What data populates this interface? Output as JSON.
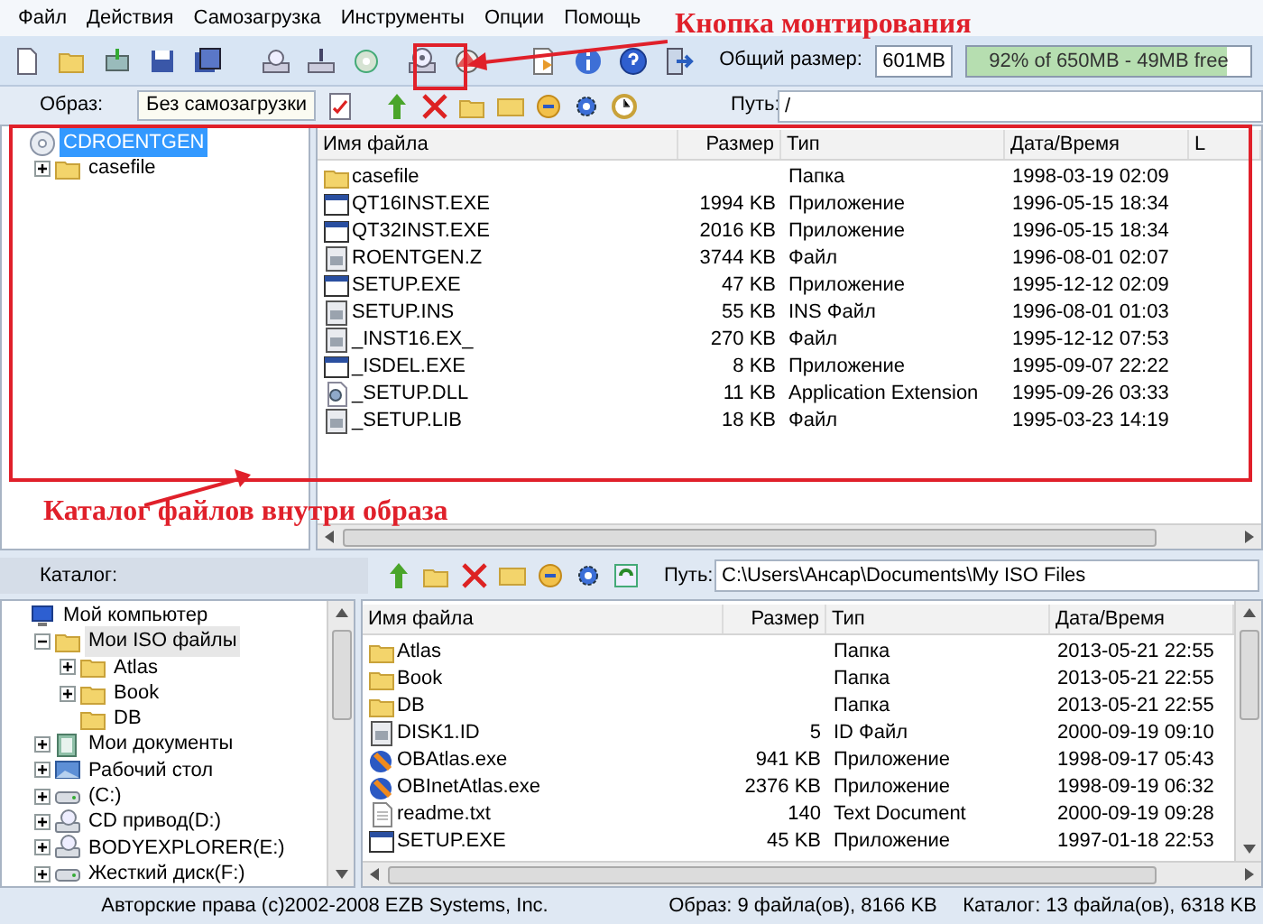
{
  "menu": [
    "Файл",
    "Действия",
    "Самозагрузка",
    "Инструменты",
    "Опции",
    "Помощь"
  ],
  "mount_callout": "Кнопка монтирования",
  "catalog_callout": "Каталог файлов внутри образа",
  "toolbar": {
    "total_size_label": "Общий размер:",
    "total_size": "601MB",
    "capacity": {
      "level": 0.92,
      "text": "92% of 650MB - 49MB free"
    }
  },
  "image_bar": {
    "label": "Образ:",
    "boot": "Без самозагрузки",
    "path_label": "Путь:",
    "path": "/"
  },
  "image_tree": [
    {
      "label": "CDROENTGEN",
      "kind": "cd",
      "selected": true,
      "children": [
        {
          "label": "casefile",
          "kind": "folder",
          "expanded": false,
          "selected": false
        }
      ]
    }
  ],
  "image_files": {
    "columns": [
      "Имя файла",
      "Размер",
      "Тип",
      "Дата/Время",
      "L"
    ],
    "rows": [
      {
        "name": "casefile",
        "size": "",
        "type": "Папка",
        "date": "1998-03-19 02:09",
        "kind": "folder"
      },
      {
        "name": "QT16INST.EXE",
        "size": "1994 KB",
        "type": "Приложение",
        "date": "1996-05-15 18:34",
        "kind": "window"
      },
      {
        "name": "QT32INST.EXE",
        "size": "2016 KB",
        "type": "Приложение",
        "date": "1996-05-15 18:34",
        "kind": "window"
      },
      {
        "name": "ROENTGEN.Z",
        "size": "3744 KB",
        "type": "Файл",
        "date": "1996-08-01 02:07",
        "kind": "file"
      },
      {
        "name": "SETUP.EXE",
        "size": "47 KB",
        "type": "Приложение",
        "date": "1995-12-12 02:09",
        "kind": "window"
      },
      {
        "name": "SETUP.INS",
        "size": "55 KB",
        "type": "INS Файл",
        "date": "1996-08-01 01:03",
        "kind": "file"
      },
      {
        "name": "_INST16.EX_",
        "size": "270 KB",
        "type": "Файл",
        "date": "1995-12-12 07:53",
        "kind": "file"
      },
      {
        "name": "_ISDEL.EXE",
        "size": "8 KB",
        "type": "Приложение",
        "date": "1995-09-07 22:22",
        "kind": "window"
      },
      {
        "name": "_SETUP.DLL",
        "size": "11 KB",
        "type": "Application Extension",
        "date": "1995-09-26 03:33",
        "kind": "gears"
      },
      {
        "name": "_SETUP.LIB",
        "size": "18 KB",
        "type": "Файл",
        "date": "1995-03-23 14:19",
        "kind": "file"
      }
    ]
  },
  "catalog_bar": {
    "label": "Каталог:",
    "path_label": "Путь:",
    "path": "C:\\Users\\Ансар\\Documents\\My ISO Files"
  },
  "catalog_tree": [
    {
      "label": "Мой компьютер",
      "kind": "computer",
      "selected": false,
      "children": [
        {
          "label": "Мои ISO файлы",
          "kind": "folder",
          "expanded": true,
          "selected": true,
          "children": [
            {
              "label": "Atlas",
              "kind": "folder",
              "expanded": false,
              "selected": false
            },
            {
              "label": "Book",
              "kind": "folder",
              "expanded": false,
              "selected": false
            },
            {
              "label": "DB",
              "kind": "folder",
              "selected": false
            }
          ]
        },
        {
          "label": "Мои документы",
          "kind": "documents",
          "expanded": false,
          "selected": false
        },
        {
          "label": "Рабочий стол",
          "kind": "desktop",
          "expanded": false,
          "selected": false
        },
        {
          "label": "(C:)",
          "kind": "drive",
          "expanded": false,
          "selected": false
        },
        {
          "label": "CD привод(D:)",
          "kind": "cddrive",
          "expanded": false,
          "selected": false
        },
        {
          "label": "BODYEXPLORER(E:)",
          "kind": "cddrive",
          "expanded": false,
          "selected": false
        },
        {
          "label": "Жесткий диск(F:)",
          "kind": "drive",
          "expanded": false,
          "selected": false
        }
      ]
    }
  ],
  "catalog_files": {
    "columns": [
      "Имя файла",
      "Размер",
      "Тип",
      "Дата/Время"
    ],
    "rows": [
      {
        "name": "Atlas",
        "size": "",
        "type": "Папка",
        "date": "2013-05-21 22:55",
        "kind": "folder"
      },
      {
        "name": "Book",
        "size": "",
        "type": "Папка",
        "date": "2013-05-21 22:55",
        "kind": "folder"
      },
      {
        "name": "DB",
        "size": "",
        "type": "Папка",
        "date": "2013-05-21 22:55",
        "kind": "folder"
      },
      {
        "name": "DISK1.ID",
        "size": "5",
        "type": "ID Файл",
        "date": "2000-09-19 09:10",
        "kind": "file"
      },
      {
        "name": "OBAtlas.exe",
        "size": "941 KB",
        "type": "Приложение",
        "date": "1998-09-17 05:43",
        "kind": "globe"
      },
      {
        "name": "OBInetAtlas.exe",
        "size": "2376 KB",
        "type": "Приложение",
        "date": "1998-09-19 06:32",
        "kind": "globe"
      },
      {
        "name": "readme.txt",
        "size": "140",
        "type": "Text Document",
        "date": "2000-09-19 09:28",
        "kind": "text"
      },
      {
        "name": "SETUP.EXE",
        "size": "45 KB",
        "type": "Приложение",
        "date": "1997-01-18 22:53",
        "kind": "window"
      }
    ]
  },
  "status_bar": [
    "Авторские права (c)2002-2008 EZB Systems, Inc.",
    "Образ: 9 файла(ов), 8166 KB",
    "Каталог: 13 файла(ов), 6318 KB"
  ]
}
